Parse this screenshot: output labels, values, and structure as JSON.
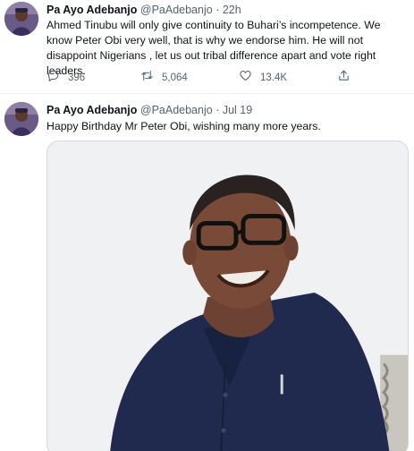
{
  "tweets": [
    {
      "author_name": "Pa Ayo Adebanjo",
      "author_handle": "@PaAdebanjo",
      "separator": "·",
      "time": "22h",
      "text": "Ahmed Tinubu will only give continuity to Buhari’s incompetence. We know Peter Obi very well, that is why we endorse him. He will not disappoint Nigerians , let us out tribal difference apart and vote right leaders.",
      "reply_count": "396",
      "retweet_count": "5,064",
      "like_count": "13.4K",
      "icons": {
        "reply": "reply-icon",
        "retweet": "retweet-icon",
        "like": "heart-icon",
        "share": "share-icon"
      }
    },
    {
      "author_name": "Pa Ayo Adebanjo",
      "author_handle": "@PaAdebanjo",
      "separator": "·",
      "time": "Jul 19",
      "text": "Happy Birthday Mr Peter Obi, wishing many more years."
    }
  ],
  "colors": {
    "text_primary": "#0f1419",
    "text_secondary": "#536471",
    "divider": "#eff3f4",
    "photo_shirt": "#1f2a4e",
    "avatar_bg": "#6a5a86"
  }
}
